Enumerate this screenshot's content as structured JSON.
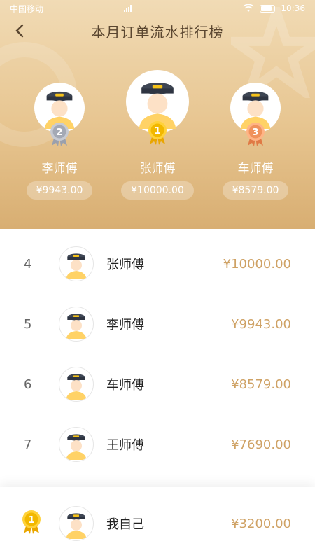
{
  "status_bar": {
    "carrier": "中国移动",
    "time": "10:36"
  },
  "header": {
    "title": "本月订单流水排行榜",
    "back_icon": "chevron-left-icon"
  },
  "podium": [
    {
      "rank": "2",
      "name": "李师傅",
      "amount": "¥9943.00",
      "medal": "silver-medal-icon"
    },
    {
      "rank": "1",
      "name": "张师傅",
      "amount": "¥10000.00",
      "medal": "gold-medal-icon"
    },
    {
      "rank": "3",
      "name": "车师傅",
      "amount": "¥8579.00",
      "medal": "bronze-medal-icon"
    }
  ],
  "ranking": [
    {
      "rank": "4",
      "name": "张师傅",
      "amount": "¥10000.00"
    },
    {
      "rank": "5",
      "name": "李师傅",
      "amount": "¥9943.00"
    },
    {
      "rank": "6",
      "name": "车师傅",
      "amount": "¥8579.00"
    },
    {
      "rank": "7",
      "name": "王师傅",
      "amount": "¥7690.00"
    }
  ],
  "me": {
    "rank": "1",
    "name": "我自己",
    "amount": "¥3200.00",
    "medal": "gold-medal-icon"
  },
  "colors": {
    "accent": "#cfa265",
    "gold": "#f5c21a",
    "silver": "#b9bcc6",
    "bronze": "#f0a06a"
  }
}
